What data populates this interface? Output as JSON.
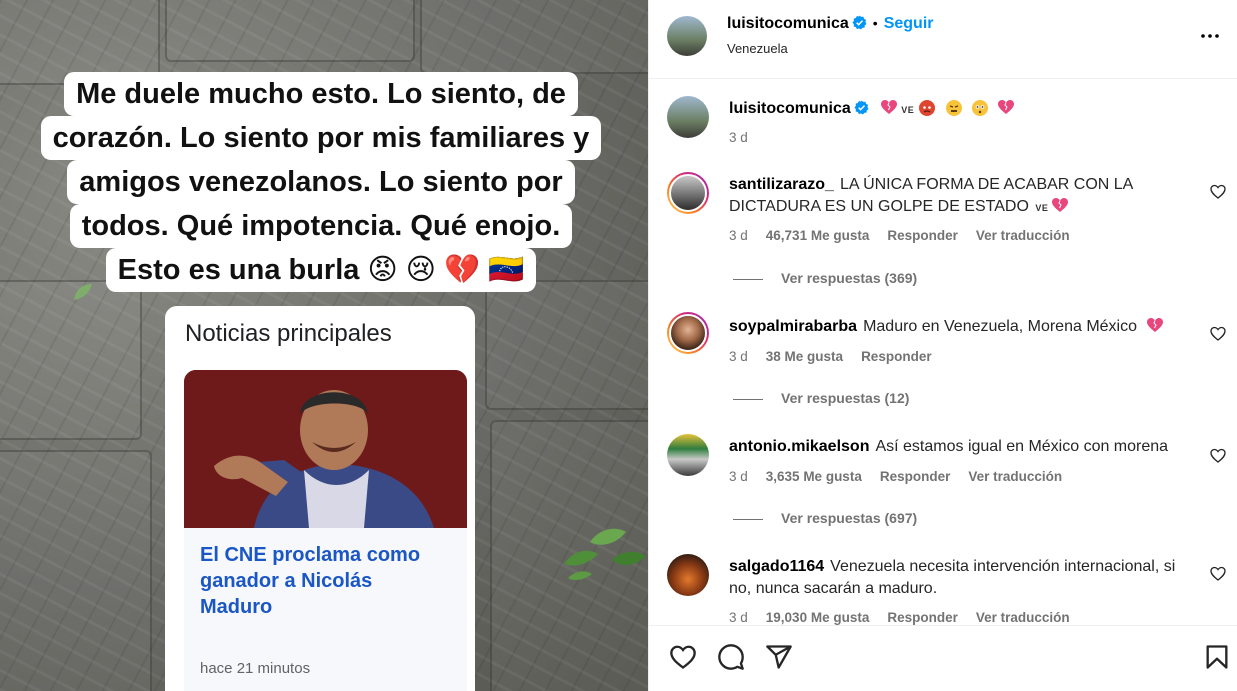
{
  "media": {
    "caption_lines": [
      "Me duele mucho esto. Lo siento, de",
      "corazón. Lo siento por mis familiares y",
      "amigos venezolanos. Lo siento por",
      "todos. Qué impotencia. Qué enojo.",
      "Esto es una burla 😡 😢 💔 🇻🇪"
    ],
    "news_card": {
      "heading": "Noticias principales",
      "title": "El CNE proclama como ganador a Nicolás Maduro",
      "time": "hace 21 minutos"
    }
  },
  "post_header": {
    "username": "luisitocomunica",
    "follow_label": "Seguir",
    "location": "Venezuela",
    "more_icon": "more-horizontal-icon"
  },
  "caption": {
    "username": "luisitocomunica",
    "flag_text": "VE",
    "time": "3 d"
  },
  "comments": [
    {
      "username": "santilizarazo_",
      "text": "LA ÚNICA FORMA DE ACABAR CON LA DICTADURA ES UN GOLPE DE ESTADO",
      "flag_text": "VE",
      "time": "3 d",
      "likes": "46,731 Me gusta",
      "reply_label": "Responder",
      "translate_label": "Ver traducción",
      "view_replies": "Ver respuestas (369)"
    },
    {
      "username": "soypalmirabarba",
      "text": "Maduro en Venezuela, Morena México",
      "time": "3 d",
      "likes": "38 Me gusta",
      "reply_label": "Responder",
      "view_replies": "Ver respuestas (12)"
    },
    {
      "username": "antonio.mikaelson",
      "text": "Así estamos igual en México con morena",
      "time": "3 d",
      "likes": "3,635 Me gusta",
      "reply_label": "Responder",
      "translate_label": "Ver traducción",
      "view_replies": "Ver respuestas (697)"
    },
    {
      "username": "salgado1164",
      "text": "Venezuela necesita intervención internacional, si no, nunca sacarán a maduro.",
      "time": "3 d",
      "likes": "19,030 Me gusta",
      "reply_label": "Responder",
      "translate_label": "Ver traducción"
    }
  ],
  "colors": {
    "accent": "#0095f6",
    "verified": "#0095f6",
    "muted_text": "#737373",
    "news_link": "#1a56c4",
    "heart_emoji": "#e8467c"
  },
  "actions": [
    "heart-icon",
    "comment-icon",
    "share-icon",
    "bookmark-icon"
  ]
}
